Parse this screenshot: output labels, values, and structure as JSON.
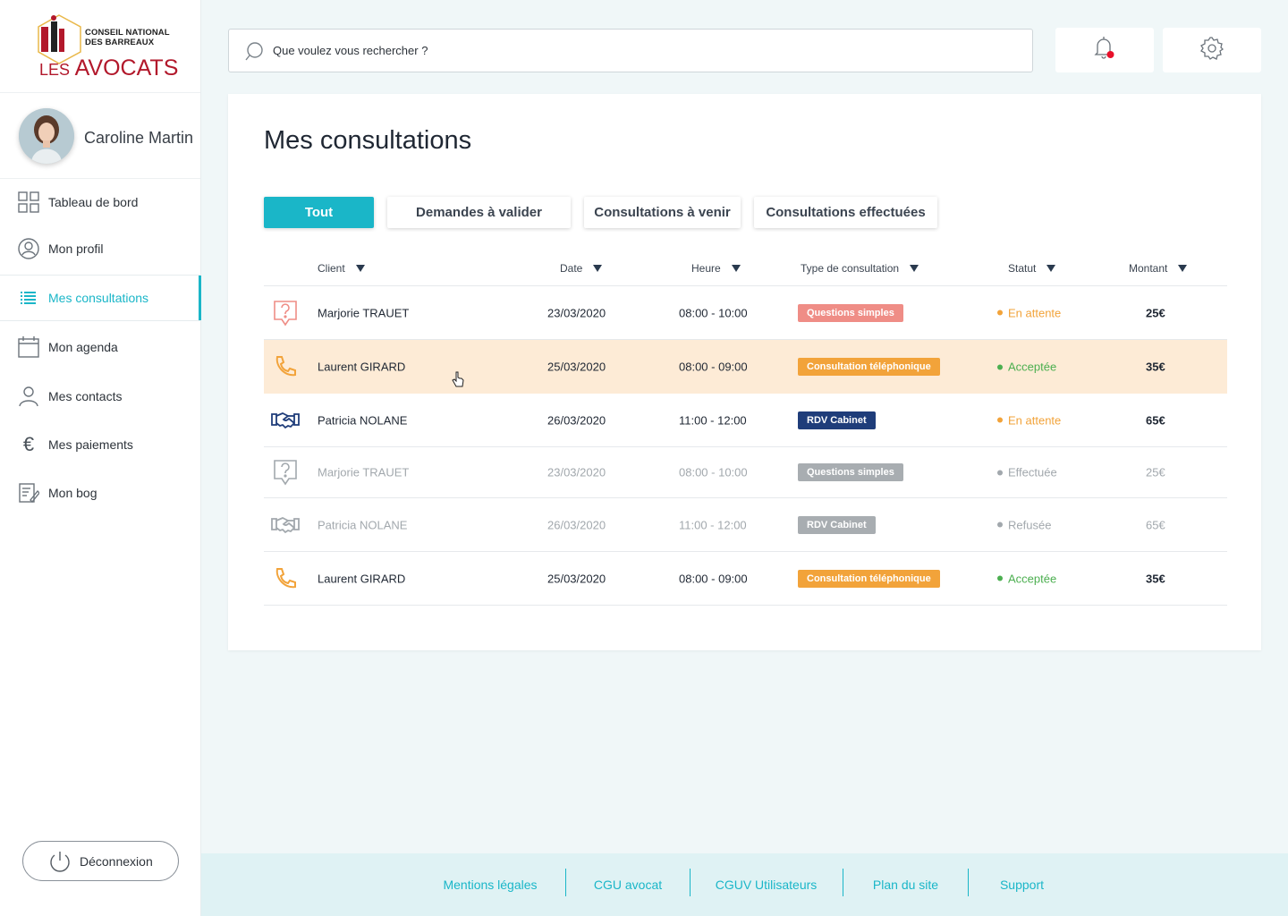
{
  "app": {
    "logo": {
      "line1": "CONSEIL NATIONAL",
      "line2": "DES BARREAUX",
      "line3_small": "LES",
      "line3_big": "AVOCATS"
    },
    "user": {
      "name": "Caroline Martin"
    },
    "sidebar": {
      "items": [
        {
          "label": "Tableau de bord",
          "icon": "dashboard-icon"
        },
        {
          "label": "Mon profil",
          "icon": "user-circle-icon"
        },
        {
          "label": "Mes consultations",
          "icon": "list-icon",
          "active": true
        },
        {
          "label": "Mon agenda",
          "icon": "calendar-icon"
        },
        {
          "label": "Mes contacts",
          "icon": "contacts-icon"
        },
        {
          "label": "Mes paiements",
          "icon": "euro-icon"
        },
        {
          "label": "Mon bog",
          "icon": "blog-edit-icon"
        }
      ],
      "logout_label": "Déconnexion"
    },
    "search": {
      "placeholder": "Que voulez vous rechercher ?"
    },
    "notifications": {
      "has_unread": true,
      "dot_color": "#e8102a"
    },
    "colors": {
      "accent": "#1ab6c8",
      "pending": "#f2a33a",
      "accepted": "#4caf50",
      "muted": "#a2a8ad"
    }
  },
  "page": {
    "title": "Mes consultations",
    "tabs": [
      "Tout",
      "Demandes à valider",
      "Consultations à venir",
      "Consultations effectuées"
    ],
    "active_tab": 0,
    "columns": [
      "Client",
      "Date",
      "Heure",
      "Type de consultation",
      "Statut",
      "Montant"
    ],
    "rows": [
      {
        "icon": "question-bubble-icon",
        "client": "Marjorie TRAUET",
        "date": "23/03/2020",
        "time": "08:00 - 10:00",
        "type": "Questions simples",
        "type_color": "#ef8d86",
        "status": "En attente",
        "status_color": "#f2a33a",
        "amount": "25€",
        "muted": false,
        "highlight": false
      },
      {
        "icon": "phone-icon",
        "client": "Laurent GIRARD",
        "date": "25/03/2020",
        "time": "08:00 - 09:00",
        "type": "Consultation téléphonique",
        "type_color": "#f2a33a",
        "status": "Acceptée",
        "status_color": "#4caf50",
        "amount": "35€",
        "muted": false,
        "highlight": true
      },
      {
        "icon": "handshake-icon",
        "client": "Patricia NOLANE",
        "date": "26/03/2020",
        "time": "11:00 - 12:00",
        "type": "RDV Cabinet",
        "type_color": "#1f3d7a",
        "status": "En attente",
        "status_color": "#f2a33a",
        "amount": "65€",
        "muted": false,
        "highlight": false
      },
      {
        "icon": "question-bubble-icon",
        "client": "Marjorie TRAUET",
        "date": "23/03/2020",
        "time": "08:00 - 10:00",
        "type": "Questions simples",
        "type_color": "#a8adb1",
        "status": "Effectuée",
        "status_color": "#a2a8ad",
        "amount": "25€",
        "muted": true,
        "highlight": false
      },
      {
        "icon": "handshake-icon",
        "client": "Patricia NOLANE",
        "date": "26/03/2020",
        "time": "11:00 - 12:00",
        "type": "RDV Cabinet",
        "type_color": "#a8adb1",
        "status": "Refusée",
        "status_color": "#a2a8ad",
        "amount": "65€",
        "muted": true,
        "highlight": false
      },
      {
        "icon": "phone-icon",
        "client": "Laurent GIRARD",
        "date": "25/03/2020",
        "time": "08:00 - 09:00",
        "type": "Consultation téléphonique",
        "type_color": "#f2a33a",
        "status": "Acceptée",
        "status_color": "#4caf50",
        "amount": "35€",
        "muted": false,
        "highlight": false
      }
    ]
  },
  "footer": {
    "links": [
      "Mentions légales",
      "CGU avocat",
      "CGUV Utilisateurs",
      "Plan du site",
      "Support"
    ]
  }
}
